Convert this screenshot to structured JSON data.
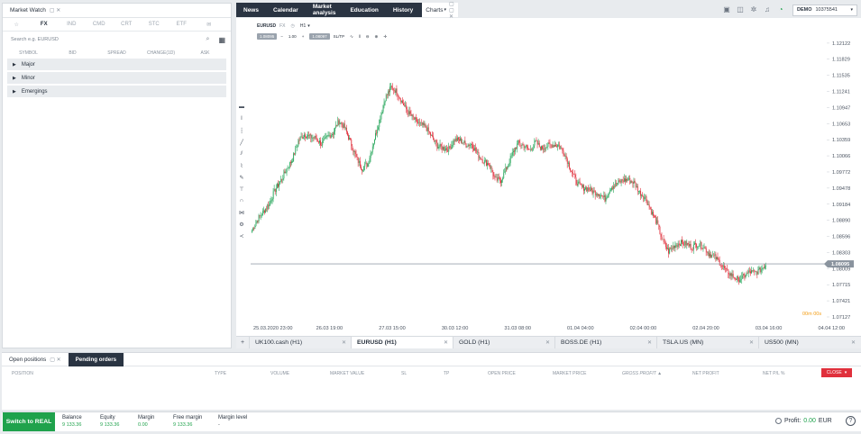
{
  "market_watch": {
    "title": "Market Watch",
    "tabs": [
      "FX",
      "IND",
      "CMD",
      "CRT",
      "STC",
      "ETF"
    ],
    "active_tab": "FX",
    "search_placeholder": "Search e.g. EURUSD",
    "columns": [
      "SYMBOL",
      "BID",
      "SPREAD",
      "CHANGE(1D)",
      "ASK"
    ],
    "groups": [
      "Major",
      "Minor",
      "Emergings"
    ]
  },
  "top_nav": {
    "items": [
      "News",
      "Calendar",
      "Market analysis",
      "Education",
      "History"
    ],
    "charts_label": "Charts"
  },
  "account": {
    "mode": "DEMO",
    "number": "10375541"
  },
  "chart_toolbar": {
    "symbol": "EURUSD",
    "market": "FX",
    "timeframe": "H1",
    "order_left": "1.08095",
    "volume": "1.00",
    "order_right": "1.08097",
    "sltp": "SL/TP"
  },
  "chart_data": {
    "type": "candlestick",
    "symbol": "EURUSD",
    "timeframe": "H1",
    "ylim": [
      1.07127,
      1.12416
    ],
    "y_ticks": [
      "1.12122",
      "1.11829",
      "1.11535",
      "1.11241",
      "1.10947",
      "1.10653",
      "1.10359",
      "1.10066",
      "1.09772",
      "1.09478",
      "1.09184",
      "1.08890",
      "1.08596",
      "1.08303",
      "1.08009",
      "1.07715",
      "1.07421",
      "1.07127"
    ],
    "x_ticks": [
      "25.03.2020 23:00",
      "26.03 19:00",
      "27.03 15:00",
      "30.03 12:00",
      "31.03 08:00",
      "01.04 04:00",
      "02.04 00:00",
      "02.04 20:00",
      "03.04 16:00",
      "04.04 12:00"
    ],
    "current_price": "1.08095",
    "countdown": "00m 00s",
    "close_path": [
      1.0871,
      1.0892,
      1.0905,
      1.0921,
      1.0945,
      1.0962,
      1.0983,
      1.1001,
      1.1034,
      1.1046,
      1.1041,
      1.1039,
      1.1028,
      1.1041,
      1.1049,
      1.107,
      1.1058,
      1.1032,
      1.1003,
      1.0984,
      1.0992,
      1.1032,
      1.1071,
      1.1112,
      1.1131,
      1.1124,
      1.1103,
      1.1086,
      1.1073,
      1.1064,
      1.1059,
      1.1042,
      1.1025,
      1.1021,
      1.1019,
      1.1036,
      1.1035,
      1.1027,
      1.1028,
      1.1009,
      1.0997,
      1.0991,
      1.0963,
      1.0962,
      1.0985,
      1.101,
      1.103,
      1.1025,
      1.1017,
      1.1032,
      1.102,
      1.1025,
      1.1027,
      1.1026,
      1.1011,
      1.0984,
      1.0959,
      1.0949,
      1.0947,
      1.0941,
      1.0938,
      1.0928,
      1.0949,
      1.0955,
      1.0962,
      1.0963,
      1.0958,
      1.094,
      1.093,
      1.0905,
      1.0884,
      1.085,
      1.0832,
      1.0843,
      1.0848,
      1.0846,
      1.084,
      1.0846,
      1.0841,
      1.0828,
      1.0822,
      1.081,
      1.0796,
      1.0788,
      1.078,
      1.0787,
      1.0795,
      1.0793,
      1.08,
      1.081
    ]
  },
  "chart_tabs": [
    {
      "label": "UK100.cash (H1)",
      "active": false
    },
    {
      "label": "EURUSD (H1)",
      "active": true
    },
    {
      "label": "GOLD (H1)",
      "active": false
    },
    {
      "label": "BOSS.DE (H1)",
      "active": false
    },
    {
      "label": "TSLA.US (MN)",
      "active": false
    },
    {
      "label": "US500 (MN)",
      "active": false
    }
  ],
  "bottom_panel": {
    "open_positions_label": "Open positions",
    "pending_orders_label": "Pending orders",
    "columns": [
      "POSITION",
      "TYPE",
      "VOLUME",
      "MARKET VALUE",
      "SL",
      "TP",
      "OPEN PRICE",
      "MARKET PRICE",
      "GROSS PROFIT ▲",
      "NET PROFIT",
      "NET P/L %"
    ],
    "close_label": "CLOSE"
  },
  "footer": {
    "switch_label": "Switch to REAL",
    "balance_label": "Balance",
    "balance": "9 133.36",
    "equity_label": "Equity",
    "equity": "9 133.36",
    "margin_label": "Margin",
    "margin": "0.00",
    "free_margin_label": "Free margin",
    "free_margin": "9 133.36",
    "margin_level_label": "Margin level",
    "margin_level": "-",
    "profit_label": "Profit:",
    "profit_value": "0.00",
    "currency": "EUR"
  },
  "colors": {
    "up": "#26a65b",
    "down": "#e0303c",
    "nav_bg": "#2a3442",
    "accent_green": "#1fa24c",
    "countdown": "#f39c12"
  }
}
